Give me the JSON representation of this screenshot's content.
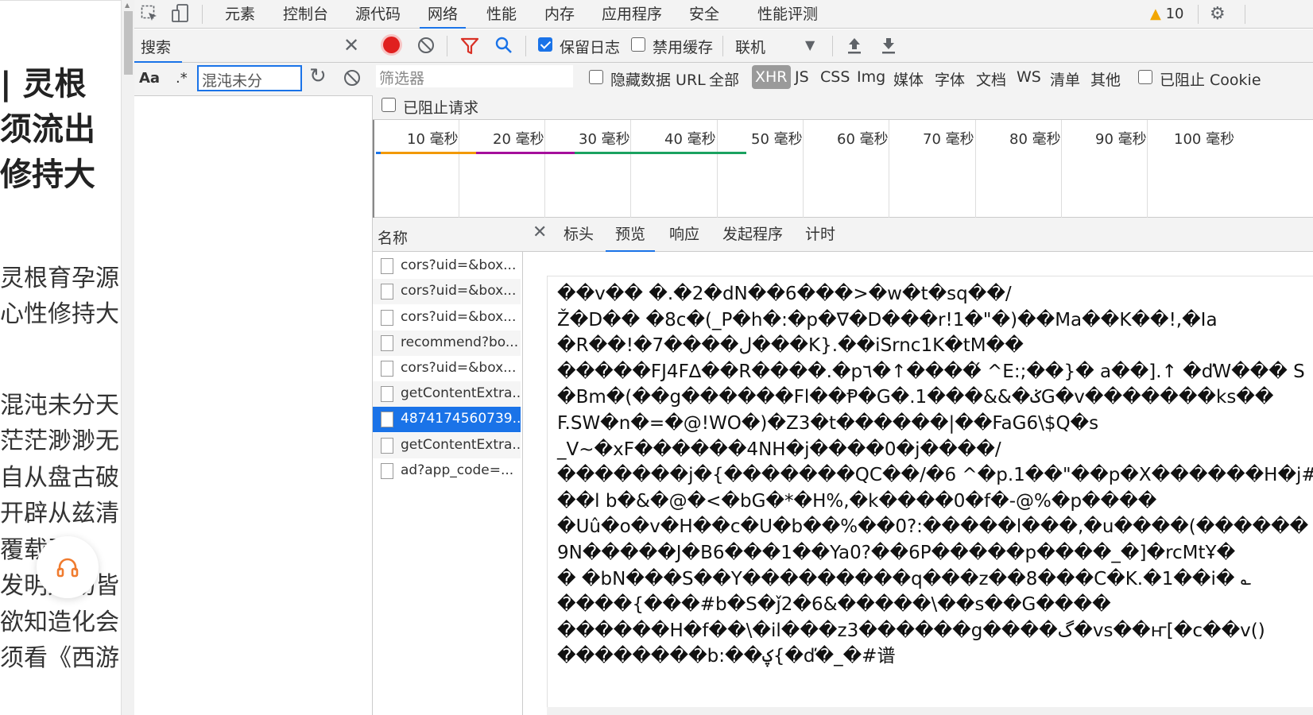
{
  "page": {
    "headline_lines": [
      "| 灵根",
      "须流出",
      "修持大"
    ],
    "paragraph_lines": [
      "灵根育孕源",
      "心性修持大",
      "混沌未分天",
      "茫茫渺渺无",
      "自从盘古破",
      "开辟从兹清",
      "覆载群",
      "发明万物皆",
      "欲知造化会",
      "须看《西游"
    ]
  },
  "devtools": {
    "top_tabs": [
      "元素",
      "控制台",
      "源代码",
      "网络",
      "性能",
      "内存",
      "应用程序",
      "安全",
      "性能评测"
    ],
    "active_top_tab": "网络",
    "warning_count": "10",
    "search": {
      "title": "搜索",
      "case_toggle": "Aa",
      "regex_toggle": ".*",
      "query": "混沌未分"
    },
    "toolbar": {
      "preserve_log": "保留日志",
      "disable_cache": "禁用缓存",
      "throttle": "联机"
    },
    "filter": {
      "placeholder": "筛选器",
      "hide_data_urls": "隐藏数据 URL",
      "types": [
        "全部",
        "XHR",
        "JS",
        "CSS",
        "Img",
        "媒体",
        "字体",
        "文档",
        "WS",
        "清单",
        "其他"
      ],
      "active_type": "XHR",
      "blocked_cookies": "已阻止 Cookie",
      "blocked_requests": "已阻止请求"
    },
    "timeline_ticks": [
      "10 毫秒",
      "20 毫秒",
      "30 毫秒",
      "40 毫秒",
      "50 毫秒",
      "60 毫秒",
      "70 毫秒",
      "80 毫秒",
      "90 毫秒",
      "100 毫秒"
    ],
    "timeline_colors": [
      "#f29900",
      "#a50e9b",
      "#1aa260"
    ],
    "requests_header": "名称",
    "requests": [
      "cors?uid=&box...",
      "cors?uid=&box...",
      "cors?uid=&box...",
      "recommend?bo...",
      "cors?uid=&box...",
      "getContentExtra...",
      "4874174560739...",
      "getContentExtra...",
      "ad?app_code=..."
    ],
    "selected_request_index": 6,
    "detail_tabs": [
      "标头",
      "预览",
      "响应",
      "发起程序",
      "计时"
    ],
    "active_detail_tab": "预览",
    "preview_lines": [
      "��v�� �.�2�dN��6���>�w�t�sq��/",
      "Ž�D�� �8c�(_P�h�:�p�∇�D���r!1�\"�)��Ma��K��!,�Ia",
      "�R��!�7����ﻝ���K}.��iSrnc1K�tM��",
      "�����FJ4F∆��R����.�p٦�↑����́ ^E:;��}� a��].↑ �ďW��� S",
      "�Bm�(��g������Fl��Ᵽ�G�.1���&&�ݢG�v�������ks��",
      "F.SW�n�=�@!WO�)�Z3�t������|��FaG6\\$Q�s",
      "_V~�xF������4NH�j����0�j����/",
      "�������j�{�������QC��/�6 ^�p.1��\"��p�X������H�j#?",
      "��l b�&�@�<�bG�*�H%,�k����0�f�-@%�p����",
      "�Uû�o�v�H��c�U�b��%��0?:�����l���,�u����(������",
      "9N�����J�B6���1��Ya0?��6P�����p����_�]�rcMtҰ�",
      "� �bN���S��Y���������q���z��8���C�K.�1��i� ؎",
      "����{���#b�S�ǰ2�6&�����\\��s��G����",
      "������H�f��\\�il���z3������g����گ�vs��ҥ[�c��v()",
      "��������b:��ؼ{�ď�_�#谱"
    ]
  }
}
